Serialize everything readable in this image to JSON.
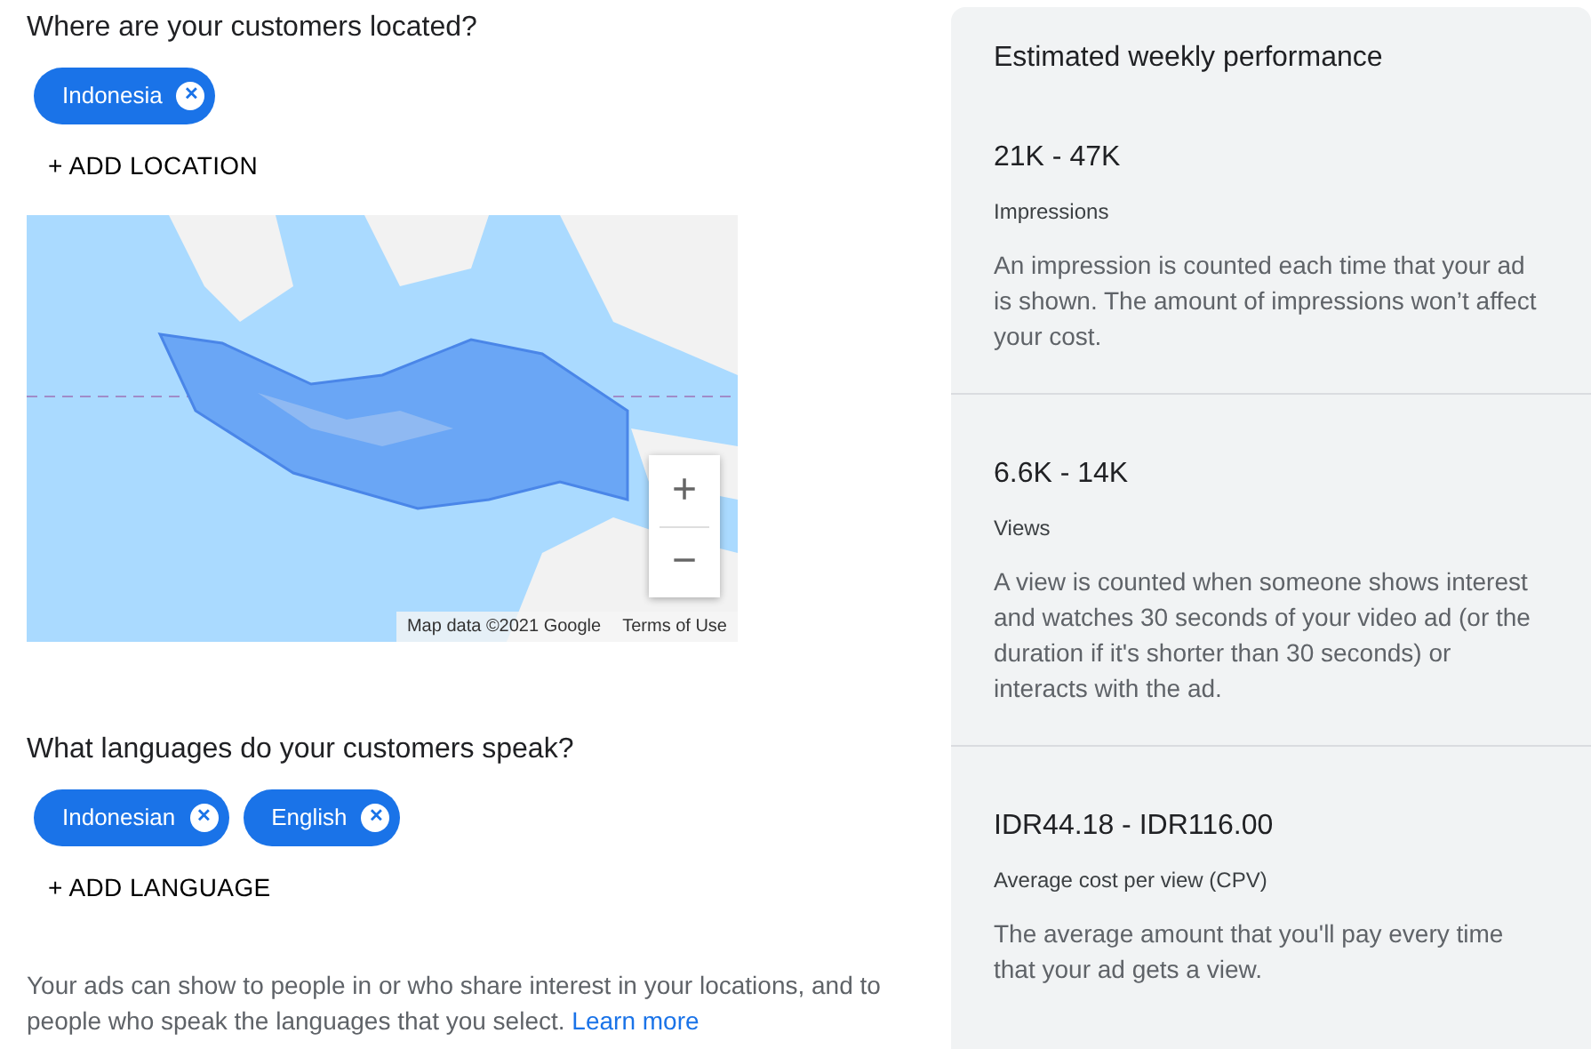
{
  "locations": {
    "title": "Where are your customers located?",
    "chips": [
      {
        "label": "Indonesia",
        "remove": "✕"
      }
    ],
    "add": "+ ADD LOCATION"
  },
  "map": {
    "kind": "picture",
    "zoom_in": "+",
    "zoom_out": "−",
    "attribution": "Map data ©2021 Google",
    "terms": "Terms of Use"
  },
  "languages": {
    "title": "What languages do your customers speak?",
    "chips": [
      {
        "label": "Indonesian",
        "remove": "✕"
      },
      {
        "label": "English",
        "remove": "✕"
      }
    ],
    "add": "+ ADD LANGUAGE"
  },
  "note": {
    "text": "Your ads can show to people in or who share interest in your locations, and to people who speak the languages that you select.",
    "link": "Learn more"
  },
  "performance": {
    "title": "Estimated weekly performance",
    "metrics": [
      {
        "value": "21K - 47K",
        "label": "Impressions",
        "description": "An impression is counted each time that your ad is shown. The amount of impressions won’t affect your cost."
      },
      {
        "value": "6.6K - 14K",
        "label": "Views",
        "description": "A view is counted when someone shows interest and watches 30 seconds of your video ad (or the duration if it's shorter than 30 seconds) or interacts with the ad."
      },
      {
        "value": "IDR44.18 - IDR116.00",
        "label": "Average cost per view (CPV)",
        "description": "The average amount that you'll pay every time that your ad gets a view."
      }
    ]
  }
}
